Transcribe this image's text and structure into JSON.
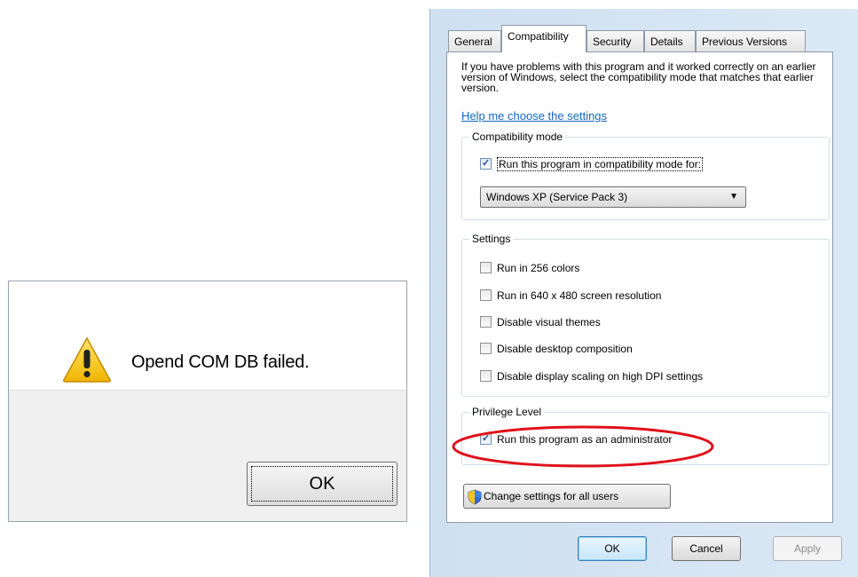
{
  "message_box": {
    "message": "Opend COM DB failed.",
    "ok_label": "OK"
  },
  "properties_dialog": {
    "tabs": [
      {
        "label": "General"
      },
      {
        "label": "Compatibility"
      },
      {
        "label": "Security"
      },
      {
        "label": "Details"
      },
      {
        "label": "Previous Versions"
      }
    ],
    "active_tab": "Compatibility",
    "intro_text": "If you have problems with this program and it worked correctly on an earlier version of Windows, select the compatibility mode that matches that earlier version.",
    "help_link": "Help me choose the settings",
    "compatibility_mode": {
      "title": "Compatibility mode",
      "checkbox_label": "Run this program in compatibility mode for:",
      "checked": true,
      "selected_os": "Windows XP (Service Pack 3)"
    },
    "settings": {
      "title": "Settings",
      "options": [
        {
          "label": "Run in 256 colors",
          "checked": false
        },
        {
          "label": "Run in 640 x 480 screen resolution",
          "checked": false
        },
        {
          "label": "Disable visual themes",
          "checked": false
        },
        {
          "label": "Disable desktop composition",
          "checked": false
        },
        {
          "label": "Disable display scaling on high DPI settings",
          "checked": false
        }
      ]
    },
    "privilege_level": {
      "title": "Privilege Level",
      "checkbox_label": "Run this program as an administrator",
      "checked": true
    },
    "change_settings_label": "Change settings for all users",
    "buttons": {
      "ok": "OK",
      "cancel": "Cancel",
      "apply": "Apply"
    }
  },
  "colors": {
    "highlight_ellipse": "#e0101a",
    "link": "#1565c0",
    "warning_yellow": "#f5c400"
  },
  "icons": [
    "warning-icon",
    "shield-icon",
    "dropdown-arrow-icon",
    "checkbox-icon"
  ]
}
